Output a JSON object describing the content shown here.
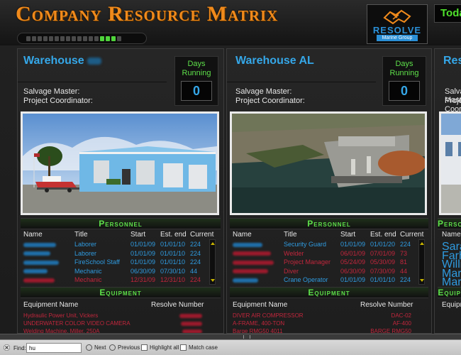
{
  "app": {
    "title": "Company Resource Matrix",
    "today_label": "Today",
    "pager": {
      "total": 17,
      "active": [
        13,
        14,
        15
      ]
    }
  },
  "logo": {
    "name": "RESOLVE",
    "sub": "Marine Group"
  },
  "labels": {
    "days_running": "Days Running",
    "salvage_master": "Salvage Master:",
    "project_coordinator": "Project Coordinator:",
    "personnel": "Personnel",
    "equipment": "Equipment",
    "col_name": "Name",
    "col_title": "Title",
    "col_start": "Start",
    "col_end": "Est. end",
    "col_current": "Current",
    "col_equipment_name": "Equipment Name",
    "col_resolve_number": "Resolve Number"
  },
  "panels": [
    {
      "name": "Warehouse",
      "days": "0",
      "personnel": [
        {
          "title": "Laborer",
          "start": "01/01/09",
          "end": "01/01/10",
          "current": "224",
          "status": "blue",
          "nw": 46
        },
        {
          "title": "Laborer",
          "start": "01/01/09",
          "end": "01/01/10",
          "current": "224",
          "status": "blue",
          "nw": 38
        },
        {
          "title": "FireSchool Staff",
          "start": "01/01/09",
          "end": "01/01/10",
          "current": "224",
          "status": "blue",
          "nw": 50
        },
        {
          "title": "Mechanic",
          "start": "06/30/09",
          "end": "07/30/10",
          "current": "44",
          "status": "blue",
          "nw": 34
        },
        {
          "title": "Mechanic",
          "start": "12/31/09",
          "end": "12/31/10",
          "current": "224",
          "status": "red",
          "nw": 44
        }
      ],
      "equipment": [
        {
          "name": "Hydraulic Power Unit, Vickers",
          "num": "",
          "nw": 32
        },
        {
          "name": "UNDERWATER COLOR VIDEO CAMERA",
          "num": "",
          "nw": 30
        },
        {
          "name": "Welding Machine, Miller, 250A",
          "num": "",
          "nw": 28
        }
      ]
    },
    {
      "name": "Warehouse AL",
      "days": "0",
      "personnel": [
        {
          "title": "Security Guard",
          "start": "01/01/09",
          "end": "01/01/20",
          "current": "224",
          "status": "blue",
          "nw": 42
        },
        {
          "title": "Welder",
          "start": "06/01/09",
          "end": "07/01/09",
          "current": "73",
          "status": "red",
          "nw": 54
        },
        {
          "title": "Project Manager",
          "start": "05/24/09",
          "end": "05/30/09",
          "current": "81",
          "status": "red",
          "nw": 58
        },
        {
          "title": "Diver",
          "start": "06/30/09",
          "end": "07/30/09",
          "current": "44",
          "status": "red",
          "nw": 50
        },
        {
          "title": "Crane Operator",
          "start": "01/01/09",
          "end": "01/01/10",
          "current": "224",
          "status": "blue",
          "nw": 36
        }
      ],
      "equipment": [
        {
          "name": "DIVER AIR COMPRESSOR",
          "num": "DAC-02"
        },
        {
          "name": "A-FRAME, 400-TON",
          "num": "AF-400"
        },
        {
          "name": "Barge RMG50 4011",
          "num": "BARGE RMG50"
        }
      ]
    },
    {
      "name": "Res",
      "personnel": [
        {
          "name": "Sarah"
        },
        {
          "name": "Farhat"
        },
        {
          "name": "William"
        },
        {
          "name": "Mary C"
        },
        {
          "name": "Maritza"
        }
      ]
    }
  ],
  "findbar": {
    "label": "Find:",
    "value": "hu",
    "next": "Next",
    "previous": "Previous",
    "highlight_all": "Highlight all",
    "match_case": "Match case"
  }
}
